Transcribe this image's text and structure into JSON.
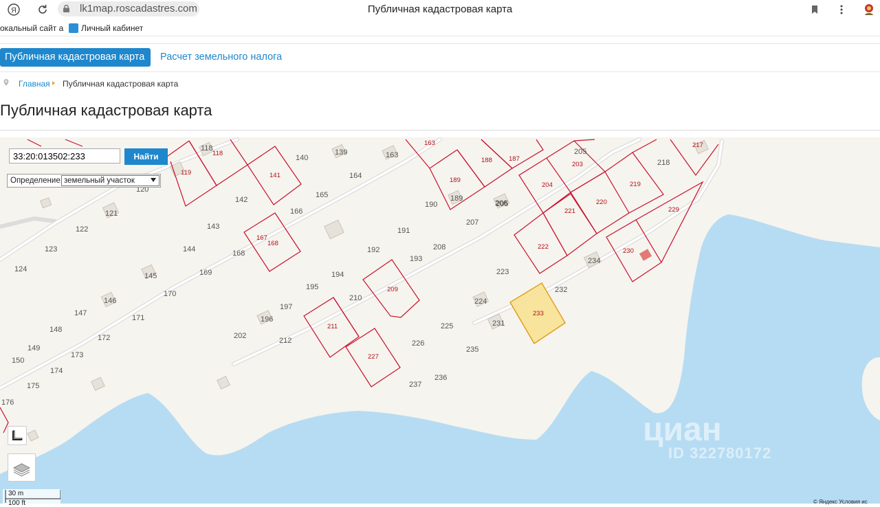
{
  "browser": {
    "address": "lk1map.roscadastres.com",
    "tab_title": "Публичная кадастровая карта",
    "icons": [
      "yandex-icon",
      "reload-icon",
      "lock-icon",
      "bookmark-icon",
      "menu-icon",
      "avatar-icon"
    ]
  },
  "bookmarks": {
    "item1": "окальный сайт а",
    "item2": "Личный кабинет"
  },
  "site_tabs": {
    "active": "Публичная кадастровая карта",
    "tax": "Расчет земельного налога"
  },
  "breadcrumb": {
    "home": "Главная",
    "current": "Публичная кадастровая карта"
  },
  "page_title": "Публичная кадастровая карта",
  "search": {
    "value": "33:20:013502:233",
    "button": "Найти"
  },
  "definition": {
    "label": "Определение:",
    "selected": "земельный участок"
  },
  "scale": {
    "top": "30 m",
    "bottom": "100 ft"
  },
  "copyright": "© Яндекс  Условия ис",
  "watermark": {
    "brand": "циан",
    "id": "ID 322780172"
  },
  "colors": {
    "accent": "#1f87cc",
    "parcel": "#c8102e",
    "selected_fill": "#f8e08e",
    "water": "#b6dcf3",
    "land": "#f6f4ee"
  },
  "parcel_labels": [
    "118",
    "120",
    "122",
    "123",
    "124",
    "140",
    "142",
    "143",
    "144",
    "147",
    "148",
    "149",
    "150",
    "164",
    "165",
    "166",
    "168",
    "169",
    "170",
    "171",
    "172",
    "173",
    "174",
    "175",
    "176",
    "190",
    "191",
    "192",
    "193",
    "194",
    "195",
    "197",
    "202",
    "205",
    "206",
    "207",
    "208",
    "210",
    "212",
    "218",
    "223",
    "225",
    "226",
    "232",
    "235",
    "236",
    "237"
  ],
  "cadastral_labels": [
    "118",
    "119",
    "141",
    "163",
    "167",
    "168",
    "188",
    "189",
    "187",
    "203",
    "204",
    "209",
    "211",
    "217",
    "219",
    "220",
    "221",
    "222",
    "227",
    "229",
    "230",
    "233"
  ],
  "building_labels": [
    "121",
    "139",
    "145",
    "146",
    "163",
    "189",
    "196",
    "205",
    "224",
    "231",
    "234"
  ]
}
